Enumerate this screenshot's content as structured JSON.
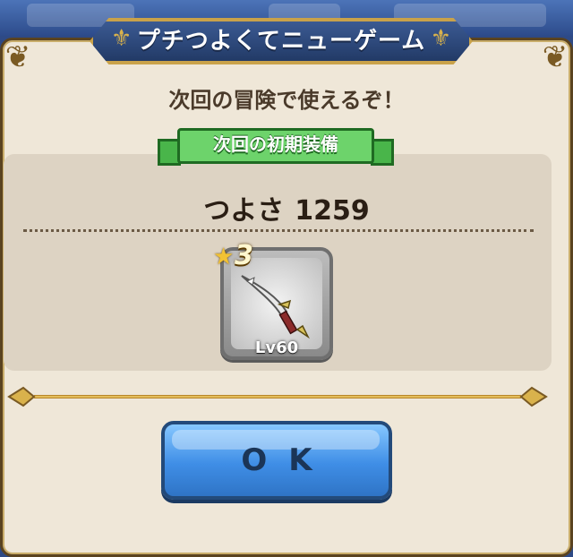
{
  "dialog": {
    "title": "プチつよくてニューゲーム",
    "subtitle": "次回の冒険で使えるぞ！",
    "section_label": "次回の初期装備",
    "power_label": "つよさ",
    "power_value": "1259"
  },
  "item": {
    "star_count": "3",
    "level_label": "Lv60",
    "icon": "sword-icon"
  },
  "ok_button": {
    "label": "OK"
  },
  "colors": {
    "title_plate": "#223a66",
    "ribbon_green": "#6dd36b",
    "button_blue": "#3f8ee6",
    "gold": "#c9a24a"
  }
}
